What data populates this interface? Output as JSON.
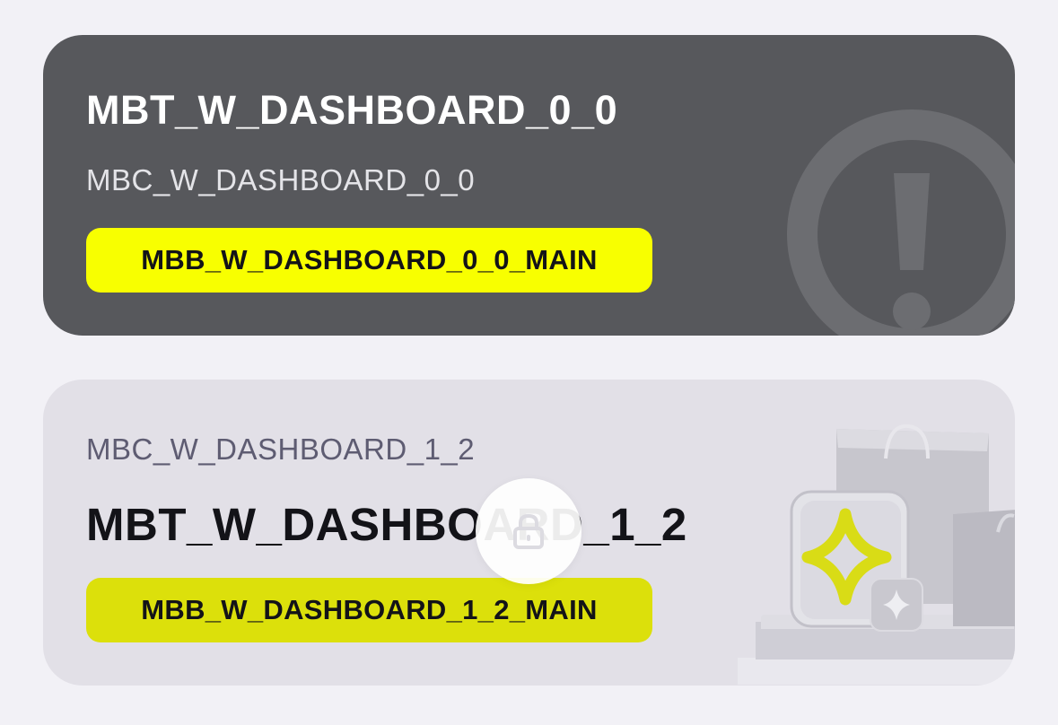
{
  "cards": [
    {
      "title": "MBT_W_DASHBOARD_0_0",
      "subtitle": "MBC_W_DASHBOARD_0_0",
      "button_label": "MBB_W_DASHBOARD_0_0_MAIN",
      "icon": "exclamation-circle-icon",
      "background": "#57585c",
      "button_color": "#f8ff00"
    },
    {
      "title": "MBT_W_DASHBOARD_1_2",
      "subtitle": "MBC_W_DASHBOARD_1_2",
      "button_label": "MBB_W_DASHBOARD_1_2_MAIN",
      "icon": "shopping-bags-sparkle-icon",
      "overlay_icon": "lock-icon",
      "background": "#e2e0e7",
      "button_color": "#dce00b"
    }
  ]
}
